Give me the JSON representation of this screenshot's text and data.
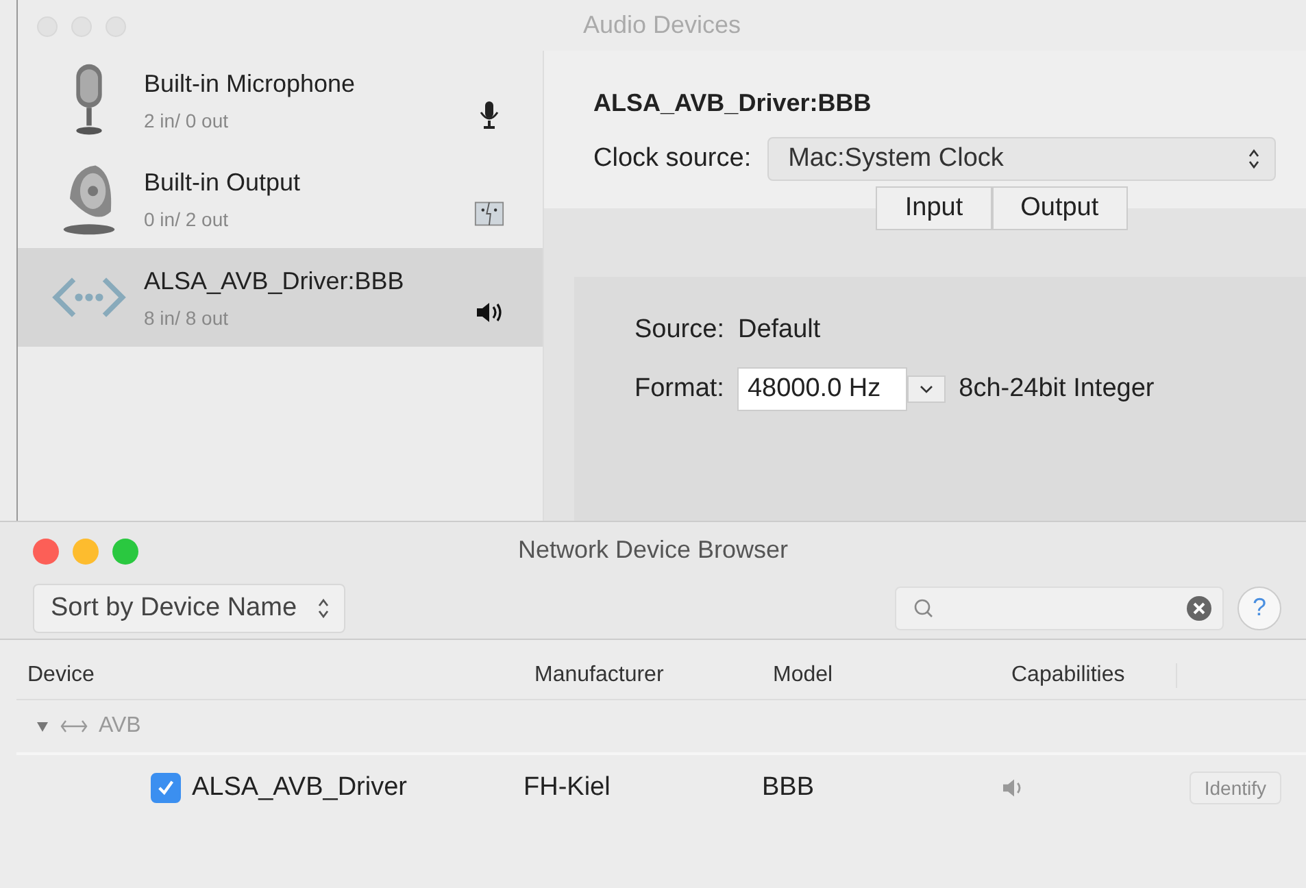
{
  "audio_window": {
    "title": "Audio Devices",
    "devices": [
      {
        "name": "Built-in Microphone",
        "channels": "2 in/ 0 out",
        "kind": "microphone",
        "badge": {
          "kind": "microphone"
        },
        "selected": false
      },
      {
        "name": "Built-in Output",
        "channels": "0 in/ 2 out",
        "kind": "speaker",
        "badge": {
          "kind": "finder"
        },
        "selected": false
      },
      {
        "name": "ALSA_AVB_Driver:BBB",
        "channels": "8 in/ 8 out",
        "kind": "network",
        "badge": {
          "kind": "speaker"
        },
        "selected": true
      }
    ],
    "detail": {
      "device_name": "ALSA_AVB_Driver:BBB",
      "clock_label": "Clock source:",
      "clock_value": "Mac:System Clock",
      "tabs": [
        {
          "label": "Input",
          "selected": false
        },
        {
          "label": "Output",
          "selected": false
        }
      ],
      "source_label": "Source:",
      "source_value": "Default",
      "format_label": "Format:",
      "format_rate": "48000.0 Hz",
      "format_type": "8ch-24bit Integer"
    }
  },
  "browser_window": {
    "title": "Network Device Browser",
    "sort": "Sort by Device Name",
    "help": "?",
    "columns": [
      "Device",
      "Manufacturer",
      "Model",
      "Capabilities"
    ],
    "groups": [
      {
        "label": "AVB",
        "expanded": true,
        "children": [
          {
            "name": "ALSA_AVB_Driver",
            "checked": true,
            "manufacturer": "FH-Kiel",
            "model": "BBB",
            "identify": "Identify",
            "identify_disabled": true
          }
        ]
      }
    ]
  }
}
